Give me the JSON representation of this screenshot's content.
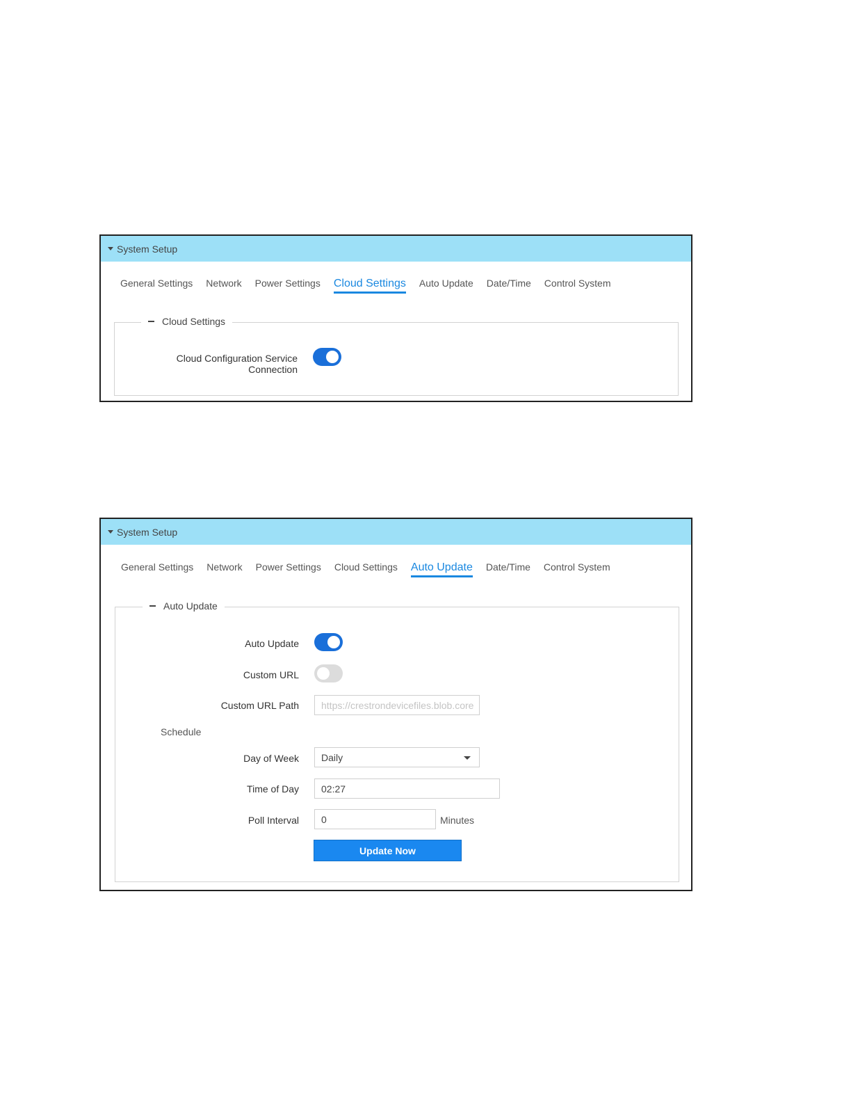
{
  "panel1": {
    "header": "System Setup",
    "tabs": [
      {
        "label": "General Settings",
        "active": false
      },
      {
        "label": "Network",
        "active": false
      },
      {
        "label": "Power Settings",
        "active": false
      },
      {
        "label": "Cloud Settings",
        "active": true
      },
      {
        "label": "Auto Update",
        "active": false
      },
      {
        "label": "Date/Time",
        "active": false
      },
      {
        "label": "Control System",
        "active": false
      }
    ],
    "section_title": "Cloud Settings",
    "cloud_config_label_1": "Cloud Configuration Service",
    "cloud_config_label_2": "Connection",
    "cloud_config_enabled": true
  },
  "panel2": {
    "header": "System Setup",
    "tabs": [
      {
        "label": "General Settings",
        "active": false
      },
      {
        "label": "Network",
        "active": false
      },
      {
        "label": "Power Settings",
        "active": false
      },
      {
        "label": "Cloud Settings",
        "active": false
      },
      {
        "label": "Auto Update",
        "active": true
      },
      {
        "label": "Date/Time",
        "active": false
      },
      {
        "label": "Control System",
        "active": false
      }
    ],
    "section_title": "Auto Update",
    "auto_update_label": "Auto Update",
    "auto_update_enabled": true,
    "custom_url_label": "Custom URL",
    "custom_url_enabled": false,
    "custom_url_path_label": "Custom URL Path",
    "custom_url_path_placeholder": "https://crestrondevicefiles.blob.core",
    "schedule_label": "Schedule",
    "day_of_week_label": "Day of Week",
    "day_of_week_value": "Daily",
    "time_of_day_label": "Time of Day",
    "time_of_day_value": "02:27",
    "poll_interval_label": "Poll Interval",
    "poll_interval_value": "0",
    "poll_interval_unit": "Minutes",
    "update_now_label": "Update Now"
  },
  "colors": {
    "header_bg": "#9de0f7",
    "accent": "#1a88e0",
    "toggle_on": "#1a6fd9",
    "toggle_off": "#dcdcdc",
    "button": "#1a88f0"
  }
}
